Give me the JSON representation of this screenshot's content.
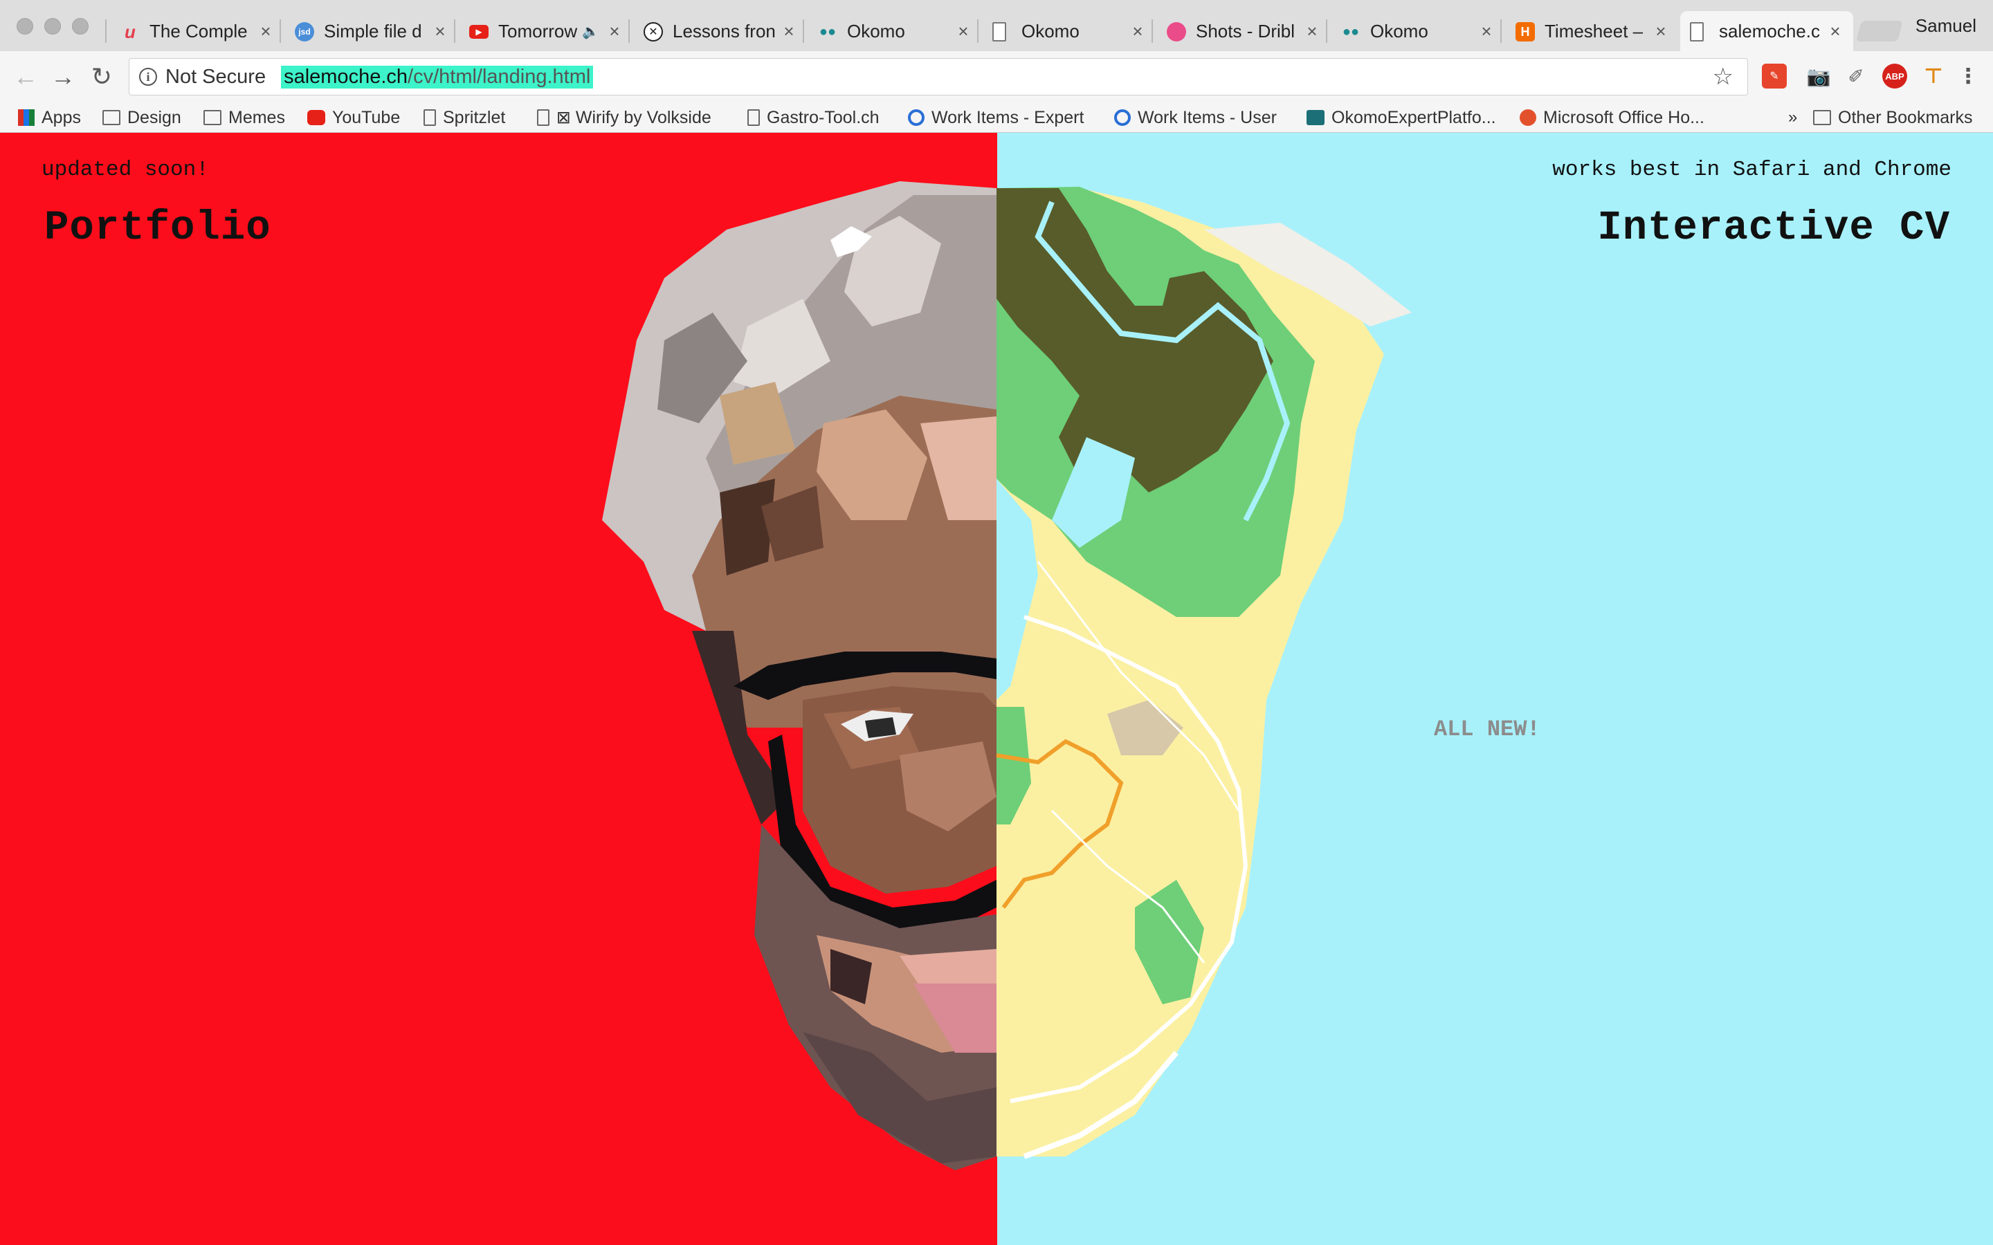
{
  "browser": {
    "tabs": [
      {
        "label": "The Comple",
        "favicon": "udemy-icon",
        "color": "#e4404e"
      },
      {
        "label": "Simple file d",
        "favicon": "jsd-icon",
        "color": "#4b8ed8"
      },
      {
        "label": "Tomorrow",
        "favicon": "youtube-icon",
        "color": "#e62117"
      },
      {
        "label": "Lessons fron",
        "favicon": "x-circle-icon",
        "color": "#222222"
      },
      {
        "label": "Okomo",
        "favicon": "okomo-icon",
        "color": "#1c8a90"
      },
      {
        "label": "Okomo",
        "favicon": "page-icon",
        "color": "#777777"
      },
      {
        "label": "Shots - Dribl",
        "favicon": "dribbble-icon",
        "color": "#ea4c89"
      },
      {
        "label": "Okomo",
        "favicon": "okomo-icon",
        "color": "#1c8a90"
      },
      {
        "label": "Timesheet –",
        "favicon": "harvest-icon",
        "color": "#f36c00"
      },
      {
        "label": "salemoche.c",
        "favicon": "page-icon",
        "color": "#777777"
      }
    ],
    "profile_name": "Samuel",
    "omnibox": {
      "security_label": "Not Secure",
      "url_host": "salemoche.ch",
      "url_path": "/cv/html/landing.html"
    },
    "bookmarks_bar": [
      {
        "label": "Apps",
        "icon": "apps-grid-icon"
      },
      {
        "label": "Design",
        "icon": "folder-icon"
      },
      {
        "label": "Memes",
        "icon": "folder-icon"
      },
      {
        "label": "YouTube",
        "icon": "youtube-icon"
      },
      {
        "label": "Spritzlet",
        "icon": "page-icon"
      },
      {
        "label": "⊠ Wirify by Volkside",
        "icon": "page-icon"
      },
      {
        "label": "Gastro-Tool.ch",
        "icon": "page-icon"
      },
      {
        "label": "Work Items - Expert",
        "icon": "azure-devops-icon"
      },
      {
        "label": "Work Items - User",
        "icon": "azure-devops-icon"
      },
      {
        "label": "OkomoExpertPlatfo...",
        "icon": "okomo-icon"
      },
      {
        "label": "Microsoft Office Ho...",
        "icon": "office-icon"
      }
    ],
    "overflow_chevron": "»",
    "other_bookmarks": "Other Bookmarks",
    "extensions": [
      "bookmark-extension-icon",
      "camera-icon",
      "pen-icon",
      "adblock-plus-icon",
      "tool-icon",
      "menu-dots-icon"
    ],
    "extension_text": {
      "abp": "ABP"
    }
  },
  "page": {
    "left": {
      "note": "updated soon!",
      "title": "Portfolio",
      "background": "#fc0d1b"
    },
    "right": {
      "note": "works best in Safari and Chrome",
      "title": "Interactive CV",
      "badge": "ALL NEW!",
      "background": "#a8f1fb"
    }
  }
}
